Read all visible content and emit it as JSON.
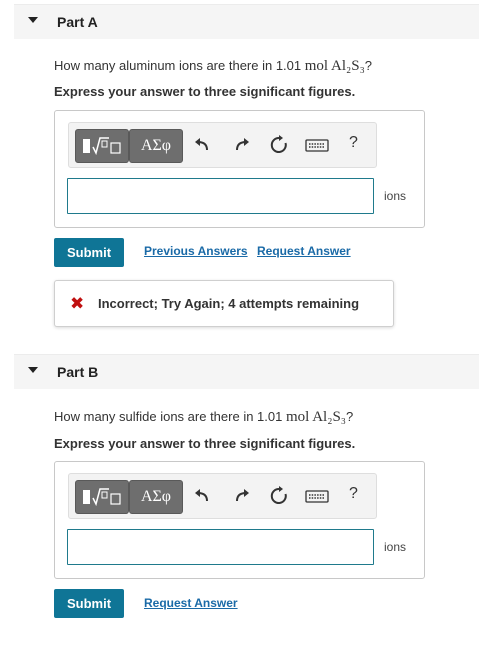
{
  "parts": [
    {
      "title": "Part A",
      "question_pre": "How many aluminum ions are there in 1.01 ",
      "question_math": "mol Al₂S₃",
      "question_post": "?",
      "instruction": "Express your answer to three significant figures.",
      "answer_value": "",
      "unit": "ions",
      "submit_label": "Submit",
      "links": [
        "Previous Answers",
        "Request Answer"
      ],
      "feedback": "Incorrect; Try Again; 4 attempts remaining"
    },
    {
      "title": "Part B",
      "question_pre": "How many sulfide ions are there in 1.01 ",
      "question_math": "mol Al₂S₃",
      "question_post": "?",
      "instruction": "Express your answer to three significant figures.",
      "answer_value": "",
      "unit": "ions",
      "submit_label": "Submit",
      "links": [
        "Request Answer"
      ]
    }
  ],
  "toolbar": {
    "symbols_label": "ΑΣφ",
    "help_label": "?",
    "icons": [
      "templates-icon",
      "undo-icon",
      "redo-icon",
      "reset-icon",
      "keyboard-icon",
      "help-icon"
    ]
  },
  "colors": {
    "submit": "#0f7596",
    "link": "#1a6aa7",
    "error": "#c01010",
    "input_border": "#1f7a8c"
  }
}
